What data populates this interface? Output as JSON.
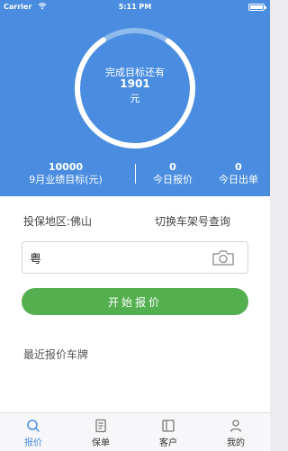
{
  "status_bar": {
    "carrier": "Carrier",
    "time": "5:11 PM"
  },
  "goal": {
    "line1": "完成目标还有",
    "amount": "1901",
    "unit": "元",
    "progress": 0.81
  },
  "stats": [
    {
      "value": "10000",
      "label": "9月业绩目标(元)"
    },
    {
      "value": "0",
      "label": "今日报价"
    },
    {
      "value": "0",
      "label": "今日出单"
    }
  ],
  "region": {
    "label": "投保地区:佛山"
  },
  "switch_link": "切换车架号查询",
  "plate_input": {
    "value": "粤",
    "placeholder": ""
  },
  "start_button": "开始报价",
  "recent_title": "最近报价车牌",
  "tabs": [
    {
      "label": "报价",
      "icon": "search-icon",
      "active": true
    },
    {
      "label": "保单",
      "icon": "document-icon",
      "active": false
    },
    {
      "label": "客户",
      "icon": "contacts-icon",
      "active": false
    },
    {
      "label": "我的",
      "icon": "person-icon",
      "active": false
    }
  ],
  "colors": {
    "header": "#4a8de0",
    "button": "#54b04f",
    "active_tab": "#4a8de0"
  }
}
